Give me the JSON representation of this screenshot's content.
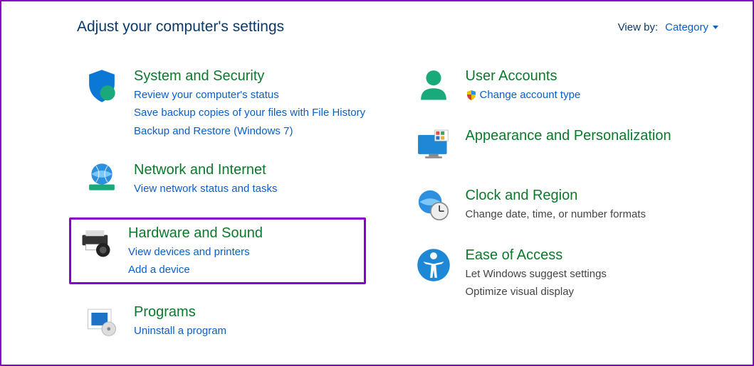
{
  "header": {
    "title": "Adjust your computer's settings",
    "viewby_label": "View by:",
    "viewby_value": "Category"
  },
  "left": [
    {
      "id": "system-security",
      "title": "System and Security",
      "links": [
        "Review your computer's status",
        "Save backup copies of your files with File History",
        "Backup and Restore (Windows 7)"
      ]
    },
    {
      "id": "network-internet",
      "title": "Network and Internet",
      "links": [
        "View network status and tasks"
      ]
    },
    {
      "id": "hardware-sound",
      "title": "Hardware and Sound",
      "links": [
        "View devices and printers",
        "Add a device"
      ],
      "highlighted": true
    },
    {
      "id": "programs",
      "title": "Programs",
      "links": [
        "Uninstall a program"
      ]
    }
  ],
  "right": [
    {
      "id": "user-accounts",
      "title": "User Accounts",
      "links": [
        "Change account type"
      ],
      "shield": true
    },
    {
      "id": "appearance",
      "title": "Appearance and Personalization",
      "links": []
    },
    {
      "id": "clock-region",
      "title": "Clock and Region",
      "subs": [
        "Change date, time, or number formats"
      ]
    },
    {
      "id": "ease-access",
      "title": "Ease of Access",
      "subs": [
        "Let Windows suggest settings",
        "Optimize visual display"
      ]
    }
  ]
}
